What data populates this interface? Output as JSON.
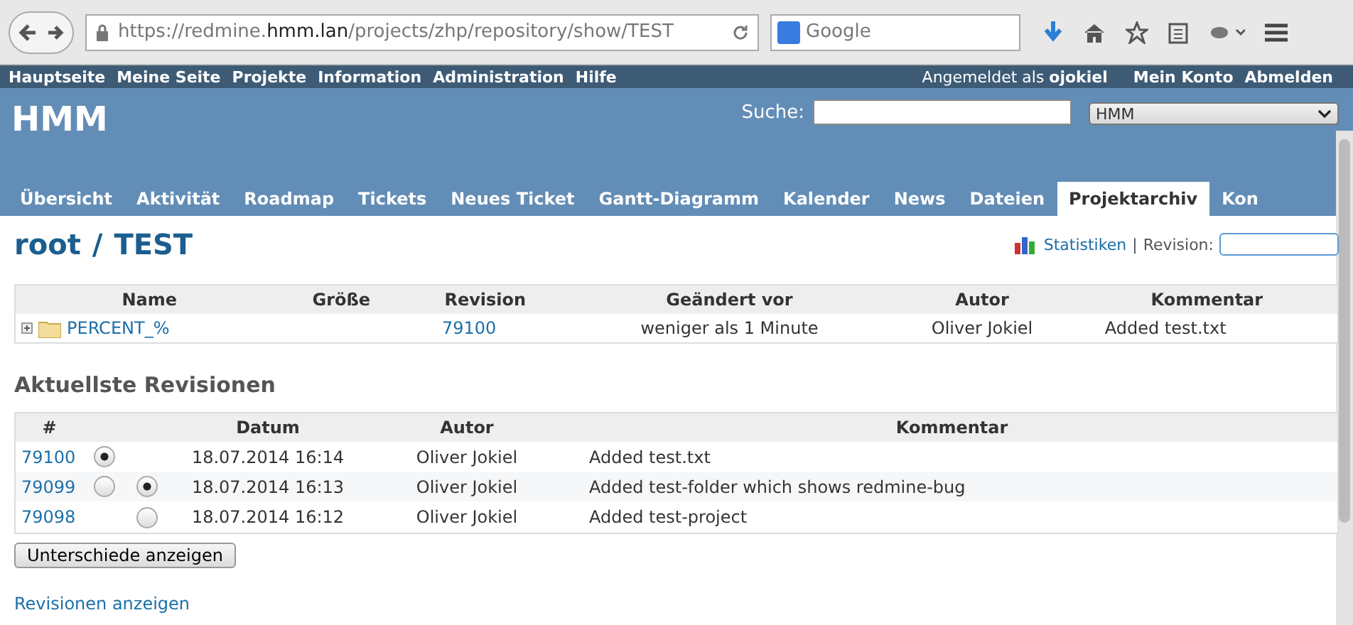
{
  "browser": {
    "url": {
      "before": "https://redmine.",
      "domain": "hmm.lan",
      "after": "/projects/zhp/repository/show/TEST"
    },
    "search_placeholder": "Google"
  },
  "top_menu": {
    "items": [
      "Hauptseite",
      "Meine Seite",
      "Projekte",
      "Information",
      "Administration",
      "Hilfe"
    ],
    "logged_in_label": "Angemeldet als",
    "user": "ojokiel",
    "account_links": [
      "Mein Konto",
      "Abmelden"
    ]
  },
  "header": {
    "title": "HMM",
    "search_label": "Suche:",
    "project_select": "HMM"
  },
  "tabs": [
    {
      "label": "Übersicht",
      "selected": false
    },
    {
      "label": "Aktivität",
      "selected": false
    },
    {
      "label": "Roadmap",
      "selected": false
    },
    {
      "label": "Tickets",
      "selected": false
    },
    {
      "label": "Neues Ticket",
      "selected": false
    },
    {
      "label": "Gantt-Diagramm",
      "selected": false
    },
    {
      "label": "Kalender",
      "selected": false
    },
    {
      "label": "News",
      "selected": false
    },
    {
      "label": "Dateien",
      "selected": false
    },
    {
      "label": "Projektarchiv",
      "selected": true
    },
    {
      "label": "Kon",
      "selected": false
    }
  ],
  "breadcrumb": {
    "root": "root",
    "separator": "/",
    "current": "TEST"
  },
  "contextual": {
    "stats_link": "Statistiken",
    "separator": "|",
    "revision_label": "Revision:"
  },
  "entries": {
    "columns": [
      "Name",
      "Größe",
      "Revision",
      "Geändert vor",
      "Autor",
      "Kommentar"
    ],
    "rows": [
      {
        "name": "PERCENT_%",
        "size": "",
        "revision": "79100",
        "age": "weniger als 1 Minute",
        "author": "Oliver Jokiel",
        "comment": "Added test.txt",
        "expanded": false
      }
    ]
  },
  "revisions": {
    "title": "Aktuellste Revisionen",
    "columns": [
      "#",
      "Datum",
      "Autor",
      "Kommentar"
    ],
    "rows": [
      {
        "id": "79100",
        "from": {
          "selected": true
        },
        "date": "18.07.2014 16:14",
        "author": "Oliver Jokiel",
        "comment": "Added test.txt"
      },
      {
        "id": "79099",
        "from": {
          "selected": false
        },
        "to": {
          "selected": true
        },
        "date": "18.07.2014 16:13",
        "author": "Oliver Jokiel",
        "comment": "Added test-folder which shows redmine-bug"
      },
      {
        "id": "79098",
        "to": {
          "selected": false
        },
        "date": "18.07.2014 16:12",
        "author": "Oliver Jokiel",
        "comment": "Added test-project"
      }
    ],
    "diff_button": "Unterschiede anzeigen",
    "all_link": "Revisionen anzeigen"
  }
}
